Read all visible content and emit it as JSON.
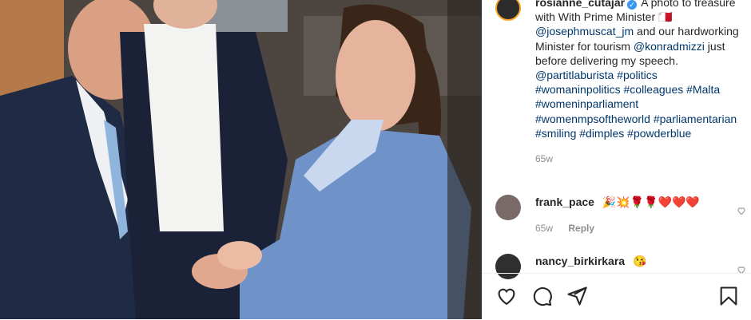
{
  "post": {
    "author": "rosianne_cutajar",
    "caption_parts": [
      {
        "t": "text",
        "v": "A photo to treasure with With Prime Minister "
      },
      {
        "t": "emoji",
        "v": "🇲🇹"
      },
      {
        "t": "text",
        "v": " "
      },
      {
        "t": "link",
        "v": "@josephmuscat_jm"
      },
      {
        "t": "text",
        "v": " and our hardworking Minister for tourism "
      },
      {
        "t": "link",
        "v": "@konradmizzi"
      },
      {
        "t": "text",
        "v": " just before delivering my speech. "
      },
      {
        "t": "link",
        "v": "@partitlaburista"
      },
      {
        "t": "text",
        "v": " "
      },
      {
        "t": "link",
        "v": "#politics"
      },
      {
        "t": "text",
        "v": " "
      },
      {
        "t": "link",
        "v": "#womaninpolitics"
      },
      {
        "t": "text",
        "v": " "
      },
      {
        "t": "link",
        "v": "#colleagues"
      },
      {
        "t": "text",
        "v": " "
      },
      {
        "t": "link",
        "v": "#Malta"
      },
      {
        "t": "text",
        "v": " "
      },
      {
        "t": "link",
        "v": "#womeninparliament"
      },
      {
        "t": "text",
        "v": " "
      },
      {
        "t": "link",
        "v": "#womenmpsoftheworld"
      },
      {
        "t": "text",
        "v": " "
      },
      {
        "t": "link",
        "v": "#parliamentarian"
      },
      {
        "t": "text",
        "v": " "
      },
      {
        "t": "link",
        "v": "#smiling"
      },
      {
        "t": "text",
        "v": " "
      },
      {
        "t": "link",
        "v": "#dimples"
      },
      {
        "t": "text",
        "v": " "
      },
      {
        "t": "link",
        "v": "#powderblue"
      }
    ],
    "age": "65w"
  },
  "comments": [
    {
      "user": "frank_pace",
      "text": "🎉💥🌹🌹❤️❤️❤️",
      "age": "65w",
      "reply": "Reply"
    },
    {
      "user": "nancy_birkirkara",
      "text": "😘"
    }
  ],
  "actions": {
    "icons": [
      "heart-icon",
      "comment-icon",
      "share-icon",
      "bookmark-icon"
    ]
  },
  "colors": {
    "link": "#00376b",
    "meta": "#8e8e8e",
    "verified": "#3897f0"
  }
}
